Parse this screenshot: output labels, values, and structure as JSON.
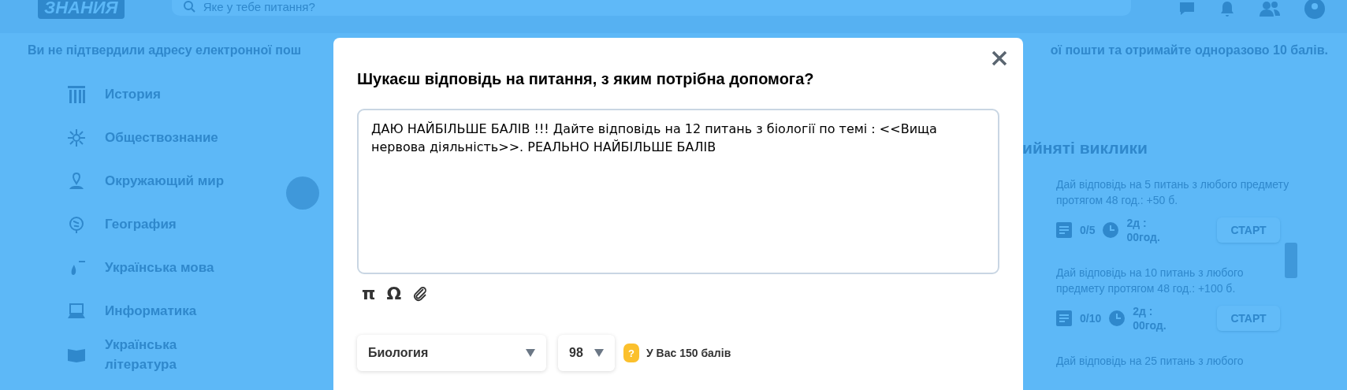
{
  "header": {
    "logo": "ЗНАНИЯ",
    "search": {
      "placeholder": "Яке у тебе питання?"
    }
  },
  "banner": [
    "Ви не підтвердили адресу електронної пош",
    "ої пошти та отримайте одноразово 10 балів."
  ],
  "sidebar": {
    "items": [
      {
        "label": "История"
      },
      {
        "label": "Обществознание"
      },
      {
        "label": "Окружающий мир"
      },
      {
        "label": "География"
      },
      {
        "label": "Українська мова"
      },
      {
        "label": "Информатика"
      },
      {
        "label": "Українська література"
      }
    ]
  },
  "challenges": {
    "heading": "ийняті виклики",
    "cards": [
      {
        "description": "Дай відповідь на 5 питань з любого предмету протягом 48 год.: +50 б.",
        "progress": "0/5",
        "time": "2д : 00год.",
        "button": "СТАРТ"
      },
      {
        "description": "Дай відповідь на 10 питань з любого предмету протягом 48 год.: +100 б.",
        "progress": "0/10",
        "time": "2д : 00год.",
        "button": "СТАРТ"
      },
      {
        "description": "Дай відповідь на 25 питань з любого"
      }
    ]
  },
  "modal": {
    "title": "Шукаєш відповідь на питання, з яким потрібна допомога?",
    "question": "ДАЮ НАЙБІЛЬШЕ БАЛІВ !!! Дайте відповідь на 12 питань з біології по темі : <<Вища нервова діяльність>>. РЕАЛЬНО НАЙБІЛЬШЕ БАЛІВ",
    "tools": [
      "π",
      "Ω"
    ],
    "subject": "Биология",
    "points": "98",
    "coin_mark": "?",
    "balance": "У Вас 150 балів"
  }
}
